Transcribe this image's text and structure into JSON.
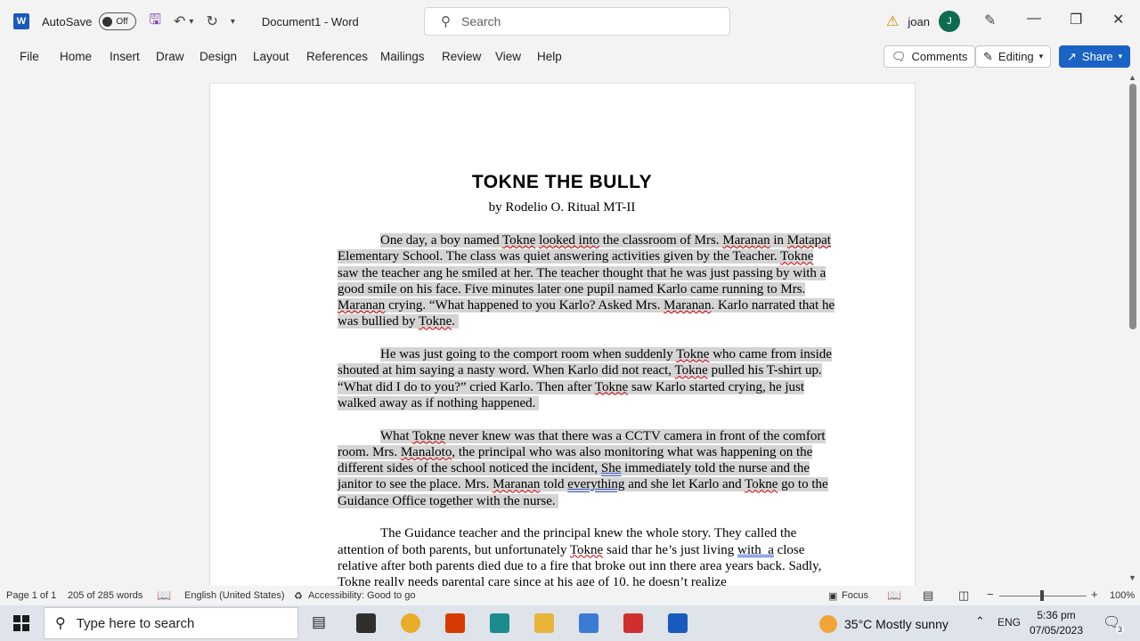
{
  "titlebar": {
    "autosave_label": "AutoSave",
    "autosave_state": "Off",
    "document_title": "Document1  -  Word",
    "search_placeholder": "Search",
    "user_name": "joan",
    "user_initial": "J"
  },
  "ribbon": {
    "tabs": [
      "File",
      "Home",
      "Insert",
      "Draw",
      "Design",
      "Layout",
      "References",
      "Mailings",
      "Review",
      "View",
      "Help"
    ],
    "comments_label": "Comments",
    "editing_label": "Editing",
    "share_label": "Share"
  },
  "document": {
    "title": "TOKNE THE BULLY",
    "byline": "by Rodelio O. Ritual MT-II"
  },
  "statusbar": {
    "page": "Page 1 of 1",
    "words": "205 of 285 words",
    "language": "English (United States)",
    "accessibility": "Accessibility: Good to go",
    "focus": "Focus",
    "zoom": "100%"
  },
  "taskbar": {
    "search_placeholder": "Type here to search",
    "weather": "35°C  Mostly sunny",
    "lang": "ENG",
    "time": "5:36 pm",
    "date": "07/05/2023",
    "notif_count": "3"
  },
  "colors": {
    "accent": "#185abd",
    "share": "#1a62c4",
    "selection": "#d4d4d4"
  }
}
